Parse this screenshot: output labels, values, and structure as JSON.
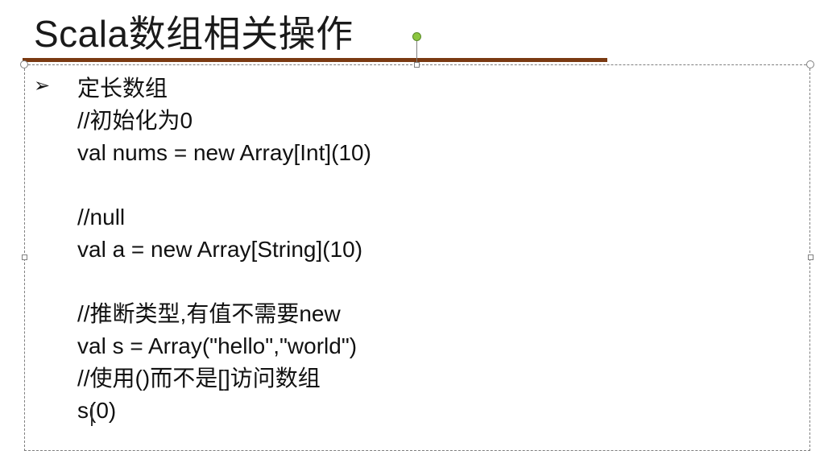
{
  "slide": {
    "title": "Scala数组相关操作",
    "section_heading": "定长数组",
    "lines": [
      "//初始化为0",
      "val nums = new Array[Int](10)",
      "",
      "//null",
      "val a = new Array[String](10)",
      "",
      "//推断类型,有值不需要new",
      "val s = Array(\"hello\",\"world\")",
      "//使用()而不是[]访问数组",
      "s(0)"
    ]
  },
  "colors": {
    "title_underline": "#7a3a12",
    "rotate_handle": "#8cc63f",
    "selection_border": "#7f7f7f"
  },
  "icons": {
    "bullet": "arrow-bullet-icon",
    "cursor": "text-cursor-icon"
  }
}
